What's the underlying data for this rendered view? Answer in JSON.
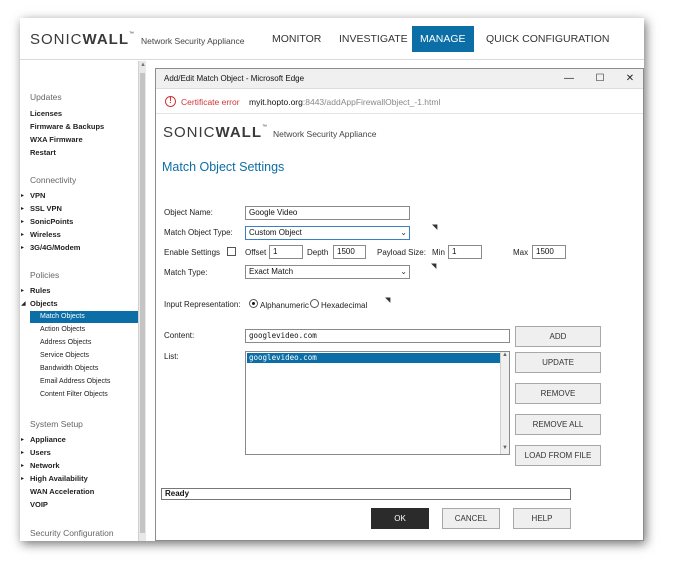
{
  "app": {
    "brand_sonic": "SONIC",
    "brand_wall": "WALL",
    "brand_tm": "™",
    "product": "Network Security Appliance"
  },
  "nav": [
    "MONITOR",
    "INVESTIGATE",
    "MANAGE",
    "QUICK CONFIGURATION"
  ],
  "nav_active": "MANAGE",
  "sidebar": {
    "updates": {
      "section": "Updates",
      "items": [
        "Licenses",
        "Firmware & Backups",
        "WXA Firmware",
        "Restart"
      ]
    },
    "connectivity": {
      "section": "Connectivity",
      "items": [
        "VPN",
        "SSL VPN",
        "SonicPoints",
        "Wireless",
        "3G/4G/Modem"
      ]
    },
    "policies": {
      "section": "Policies",
      "items": [
        "Rules",
        "Objects"
      ],
      "objects_sub": [
        "Match Objects",
        "Action Objects",
        "Address Objects",
        "Service Objects",
        "Bandwidth Objects",
        "Email Address Objects",
        "Content Filter Objects"
      ],
      "active_sub": "Match Objects"
    },
    "system_setup": {
      "section": "System Setup",
      "items": [
        "Appliance",
        "Users",
        "Network",
        "High Availability",
        "WAN Acceleration",
        "VOIP"
      ]
    },
    "security_configuration": {
      "section": "Security Configuration"
    }
  },
  "dialog": {
    "window_title": "Add/Edit Match Object - Microsoft Edge",
    "cert_error": "Certificate error",
    "url_host": "myit.hopto.org",
    "url_path": ":8443/addAppFirewallObject_-1.html",
    "heading": "Match Object Settings",
    "form": {
      "object_name_label": "Object Name:",
      "object_name_value": "Google Video",
      "match_object_type_label": "Match Object Type:",
      "match_object_type_value": "Custom Object",
      "enable_settings_label": "Enable Settings",
      "offset_label": "Offset",
      "offset_value": "1",
      "depth_label": "Depth",
      "depth_value": "1500",
      "payload_size_label": "Payload Size:",
      "min_label": "Min",
      "min_value": "1",
      "max_label": "Max",
      "max_value": "1500",
      "match_type_label": "Match Type:",
      "match_type_value": "Exact Match",
      "input_rep_label": "Input Representation:",
      "alphanumeric_label": "Alphanumeric",
      "hexadecimal_label": "Hexadecimal",
      "content_label": "Content:",
      "content_value": "googlevideo.com",
      "list_label": "List:",
      "list_items": [
        "googlevideo.com"
      ]
    },
    "buttons": {
      "add": "ADD",
      "update": "UPDATE",
      "remove": "REMOVE",
      "remove_all": "REMOVE ALL",
      "load_from_file": "LOAD FROM FILE",
      "ok": "OK",
      "cancel": "CANCEL",
      "help": "HELP"
    },
    "status": "Ready"
  },
  "colors": {
    "accent": "#0c6ea6",
    "error": "#d13438",
    "primary_button": "#2b2b2b"
  }
}
